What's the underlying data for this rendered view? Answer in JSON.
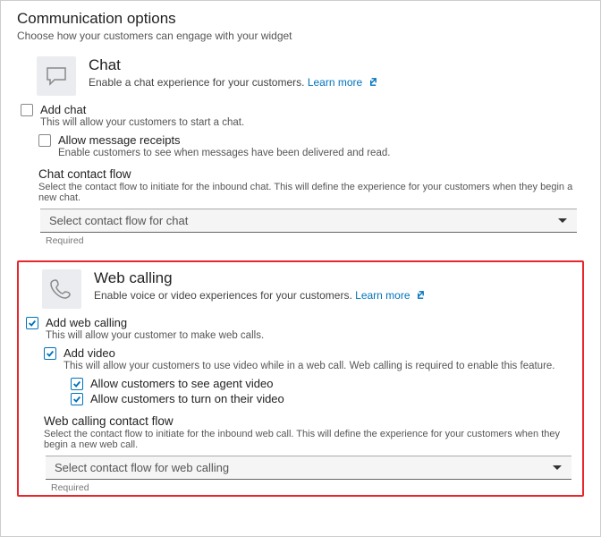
{
  "header": {
    "title": "Communication options",
    "subtitle": "Choose how your customers can engage with your widget"
  },
  "chat": {
    "title": "Chat",
    "desc": "Enable a chat experience for your customers.",
    "learn_more": "Learn more",
    "add_label": "Add chat",
    "add_desc": "This will allow your customers to start a chat.",
    "receipts_label": "Allow message receipts",
    "receipts_desc": "Enable customers to see when messages have been delivered and read.",
    "flow_title": "Chat contact flow",
    "flow_desc": "Select the contact flow to initiate for the inbound chat. This will define the experience for your customers when they begin a new chat.",
    "flow_select": "Select contact flow for chat",
    "required": "Required"
  },
  "web": {
    "title": "Web calling",
    "desc": "Enable voice or video experiences for your customers.",
    "learn_more": "Learn more",
    "add_label": "Add web calling",
    "add_desc": "This will allow your customer to make web calls.",
    "video_label": "Add video",
    "video_desc": "This will allow your customers to use video while in a web call. Web calling is required to enable this feature.",
    "allow_agent": "Allow customers to see agent video",
    "allow_self": "Allow customers to turn on their video",
    "flow_title": "Web calling contact flow",
    "flow_desc": "Select the contact flow to initiate for the inbound web call. This will define the experience for your customers when they begin a new web call.",
    "flow_select": "Select contact flow for web calling",
    "required": "Required"
  }
}
